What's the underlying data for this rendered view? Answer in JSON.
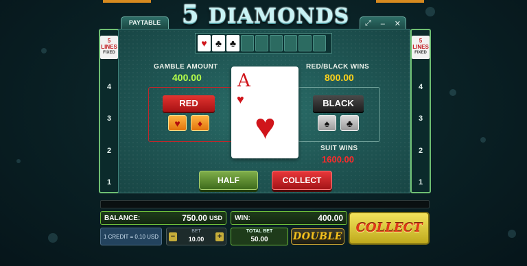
{
  "title": {
    "number": "5",
    "word": "DIAMONDS"
  },
  "tabs": {
    "paytable": "PAYTABLE"
  },
  "window_controls": [
    "⤢",
    "–",
    "✕"
  ],
  "side_reels": {
    "badge_lines": "5 LINES",
    "badge_fixed": "FIXED",
    "numbers": [
      "4",
      "3",
      "2",
      "1"
    ]
  },
  "history": {
    "cards": [
      {
        "type": "face",
        "suit": "♥",
        "color": "red"
      },
      {
        "type": "face",
        "suit": "♣",
        "color": "black"
      },
      {
        "type": "face",
        "suit": "♣",
        "color": "black"
      },
      {
        "type": "back"
      },
      {
        "type": "back"
      },
      {
        "type": "back"
      },
      {
        "type": "back"
      },
      {
        "type": "back"
      },
      {
        "type": "back"
      }
    ]
  },
  "gamble": {
    "gamble_amount_label": "GAMBLE AMOUNT",
    "gamble_amount_value": "400.00",
    "red_black_label": "RED/BLACK WINS",
    "red_black_value": "800.00",
    "suit_label": "SUIT WINS",
    "suit_value": "1600.00",
    "red_button": "RED",
    "black_button": "BLACK",
    "red_suits": [
      "♥",
      "♦"
    ],
    "black_suits": [
      "♠",
      "♣"
    ],
    "card": {
      "rank": "A",
      "suit": "♥"
    },
    "half_button": "HALF",
    "collect_button": "COLLECT"
  },
  "bottom": {
    "balance_label": "BALANCE:",
    "balance_value": "750.00",
    "balance_currency": "USD",
    "win_label": "WIN:",
    "win_value": "400.00",
    "credit_text": "1 CREDIT = 0.10 USD",
    "bet_label": "BET",
    "bet_value": "10.00",
    "bet_minus": "−",
    "bet_plus": "+",
    "total_bet_label": "TOTAL BET",
    "total_bet_value": "50.00",
    "double_button": "DOUBLE",
    "collect_button": "COLLECT"
  },
  "colors": {
    "accent_green": "#b6ff4a",
    "accent_yellow": "#ffd21a",
    "suit_red": "#d0151b"
  }
}
